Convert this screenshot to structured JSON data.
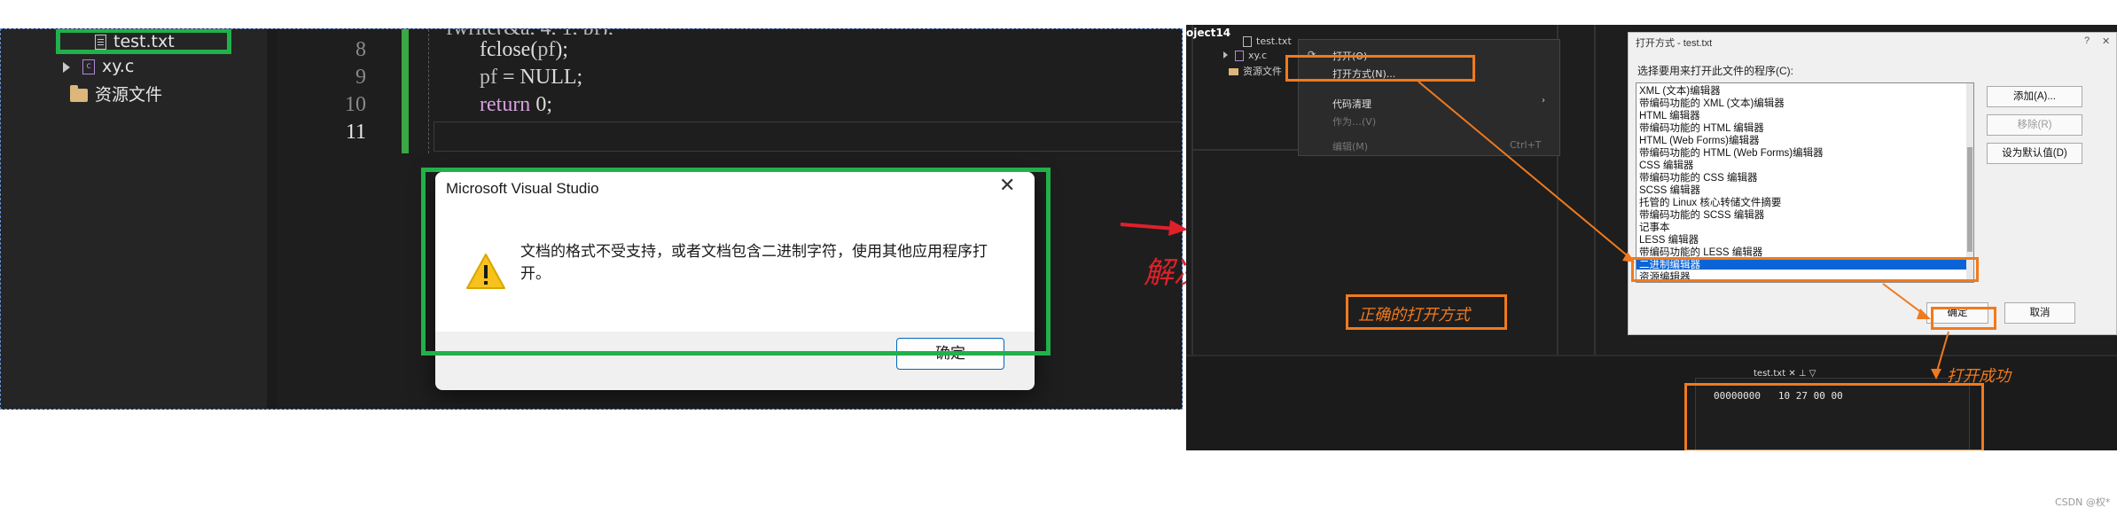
{
  "left_panel": {
    "tree": {
      "file_txt": "test.txt",
      "file_c": "xy.c",
      "folder_resources": "资源文件"
    },
    "editor": {
      "lines": [
        {
          "num": "8",
          "tokens": [
            "fclose",
            "(",
            "pf",
            ");"
          ]
        },
        {
          "num": "9",
          "tokens": [
            "pf",
            " = ",
            "NULL",
            ";"
          ]
        },
        {
          "num": "10",
          "tokens": [
            "return",
            " 0;"
          ]
        },
        {
          "num": "11",
          "tokens": []
        }
      ]
    },
    "dialog": {
      "title": "Microsoft Visual Studio",
      "close": "✕",
      "message": "文档的格式不受支持，或者文档包含二进制字符，使用其他应用程序打开。",
      "ok_label": "确定"
    }
  },
  "annotation_middle": "解决方法",
  "right_panel": {
    "project_label": "oject14",
    "tree": {
      "file_txt": "test.txt",
      "file_c": "xy.c",
      "folder_resources": "资源文件"
    },
    "context_menu": {
      "items": [
        {
          "label": "打开(O)",
          "enabled": true
        },
        {
          "label": "打开方式(N)...",
          "enabled": true
        },
        {
          "label": "代码清理",
          "enabled": true
        },
        {
          "label": "作为…(V)",
          "enabled": false
        },
        {
          "label": "编辑(M)",
          "enabled": false,
          "shortcut": "Ctrl+T"
        }
      ]
    },
    "open_with": {
      "title": "打开方式 - test.txt",
      "help": "?",
      "close": "✕",
      "prompt": "选择要用来打开此文件的程序(C):",
      "programs": [
        "XML (文本)编辑器",
        "带编码功能的 XML (文本)编辑器",
        "HTML 编辑器",
        "带编码功能的 HTML 编辑器",
        "HTML (Web Forms)编辑器",
        "带编码功能的 HTML (Web Forms)编辑器",
        "CSS 编辑器",
        "带编码功能的 CSS 编辑器",
        "SCSS 编辑器",
        "托管的 Linux 核心转储文件摘要",
        "带编码功能的 SCSS 编辑器",
        "记事本",
        "LESS 编辑器",
        "带编码功能的 LESS 编辑器",
        "二进制编辑器",
        "资源编辑器"
      ],
      "selected_index": 14,
      "buttons": {
        "add": "添加(A)...",
        "remove": "移除(R)",
        "set_default": "设为默认值(D)",
        "ok": "确定",
        "cancel": "取消"
      }
    },
    "note_correct": "正确的打开方式",
    "note_success": "打开成功",
    "hex_tab": "test.txt",
    "hex_line": "00000000   10 27 00 00"
  },
  "watermark": "CSDN @权*",
  "colors": {
    "green_highlight": "#21b14a",
    "orange_highlight": "#f07a1e",
    "red_annotation": "#e0202a",
    "selection_blue": "#0a64d6"
  }
}
